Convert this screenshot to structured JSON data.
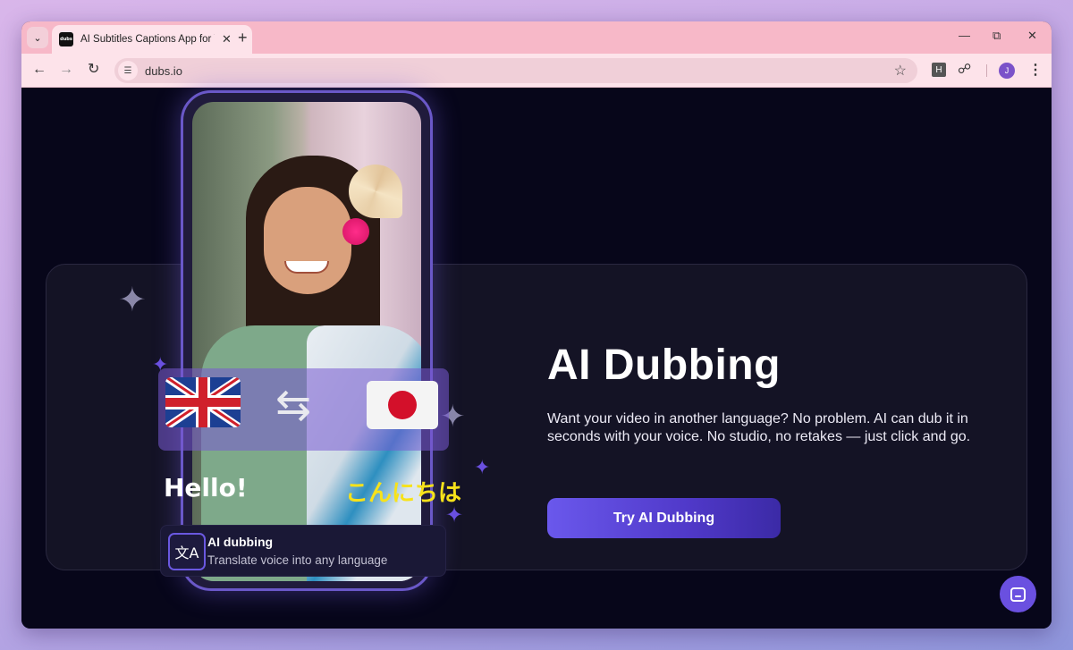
{
  "browser": {
    "tab_title": "AI Subtitles Captions App for YouTube",
    "tab_favicon_text": "dubs",
    "new_tab_label": "+",
    "url": "dubs.io",
    "extension_h": "H",
    "avatar_initial": "J"
  },
  "hero": {
    "badge_left_text": "Hello!",
    "badge_right_text": "こんにちは",
    "feature_title": "AI dubbing",
    "feature_subtitle": "Translate voice into any language",
    "headline": "AI Dubbing",
    "description": "Want your video in another language? No problem. AI can dub it in seconds with your voice. No studio, no retakes — just click and go.",
    "cta_label": "Try AI Dubbing"
  },
  "colors": {
    "page_bg": "#07061a",
    "card_bg": "#141325",
    "accent": "#6a50e0",
    "tab_strip": "#f7b8c8",
    "konnichiwa_yellow": "#f7e21a"
  },
  "icons": {
    "tab_search": "chevron-down-icon",
    "back": "arrow-left-icon",
    "forward": "arrow-right-icon",
    "reload": "reload-icon",
    "site_info": "tune-icon",
    "bookmark": "star-icon",
    "extensions": "puzzle-icon",
    "menu": "kebab-icon",
    "swap": "refresh-icon",
    "translate": "translate-icon",
    "chat": "chat-icon"
  }
}
